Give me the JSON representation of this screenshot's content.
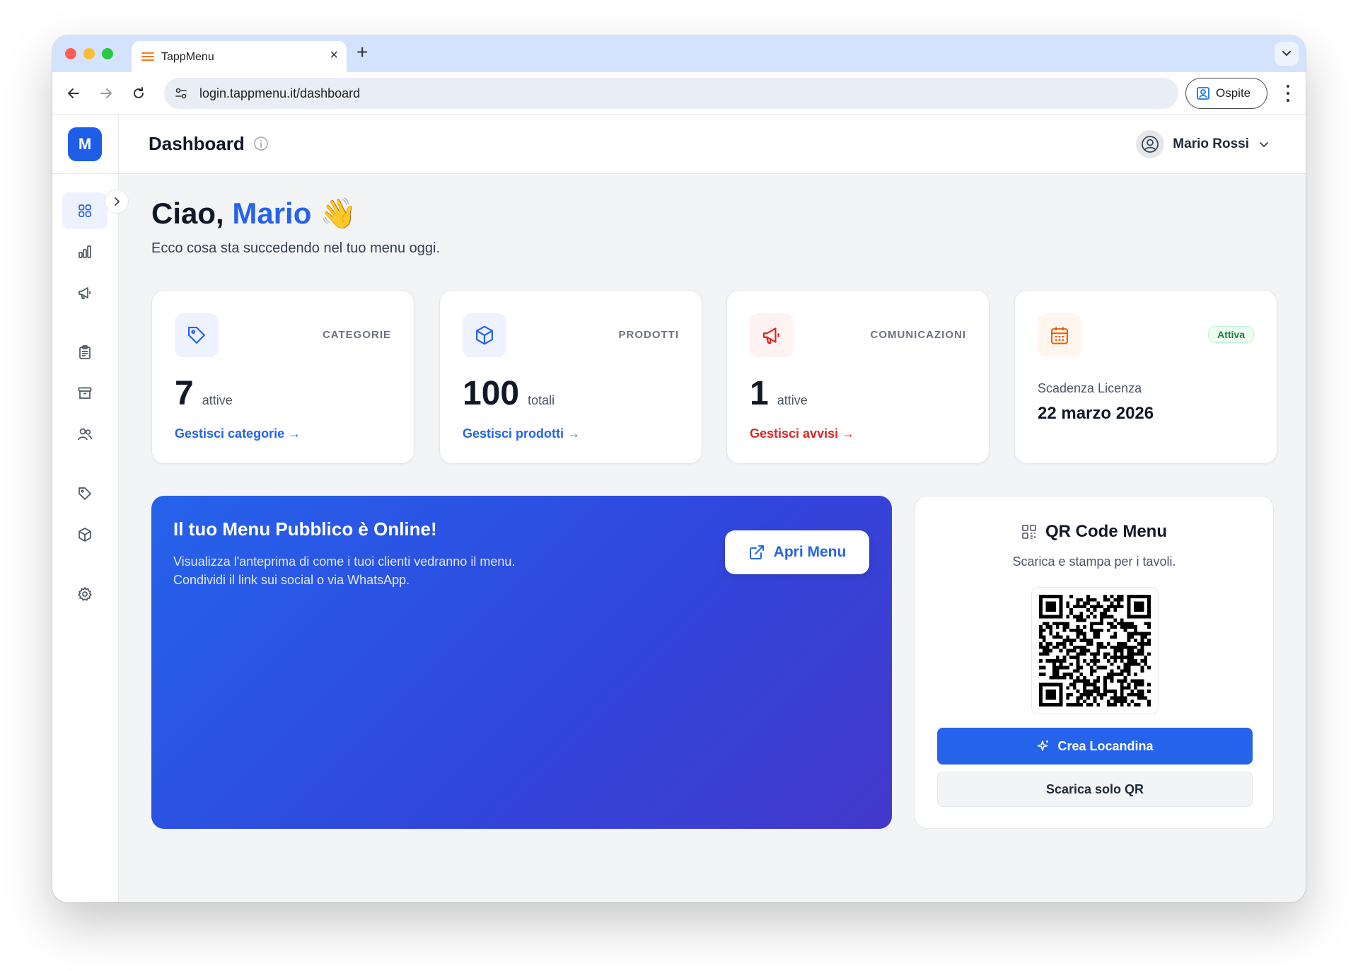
{
  "browser": {
    "tab_title": "TappMenu",
    "url": "login.tappmenu.it/dashboard",
    "profile_label": "Ospite"
  },
  "app": {
    "logo_letter": "M",
    "page_title": "Dashboard",
    "user_name": "Mario Rossi"
  },
  "greeting": {
    "prefix": "Ciao, ",
    "name": "Mario",
    "emoji": "👋",
    "subtitle": "Ecco cosa sta succedendo nel tuo menu oggi."
  },
  "cards": {
    "categories": {
      "label": "CATEGORIE",
      "value": "7",
      "unit": "attive",
      "link": "Gestisci categorie →"
    },
    "products": {
      "label": "PRODOTTI",
      "value": "100",
      "unit": "totali",
      "link": "Gestisci prodotti →"
    },
    "communications": {
      "label": "COMUNICAZIONI",
      "value": "1",
      "unit": "attive",
      "link": "Gestisci avvisi →"
    },
    "license": {
      "badge": "Attiva",
      "label": "Scadenza Licenza",
      "date": "22 marzo 2026"
    }
  },
  "hero": {
    "title": "Il tuo Menu Pubblico è Online!",
    "line1": "Visualizza l'anteprima di come i tuoi clienti vedranno il menu.",
    "line2": "Condividi il link sui social o via WhatsApp.",
    "button": "Apri Menu"
  },
  "qr": {
    "title": "QR Code Menu",
    "subtitle": "Scarica e stampa per i tavoli.",
    "primary_button": "Crea Locandina",
    "secondary_button": "Scarica solo QR"
  },
  "sidebar_icons": [
    "grid-icon",
    "bar-chart-icon",
    "megaphone-icon",
    "clipboard-icon",
    "archive-icon",
    "users-icon",
    "tag-icon",
    "box-icon",
    "settings-icon"
  ],
  "colors": {
    "accent": "#2563eb",
    "danger": "#dc2626",
    "success": "#15803d",
    "orange": "#ea580c"
  }
}
